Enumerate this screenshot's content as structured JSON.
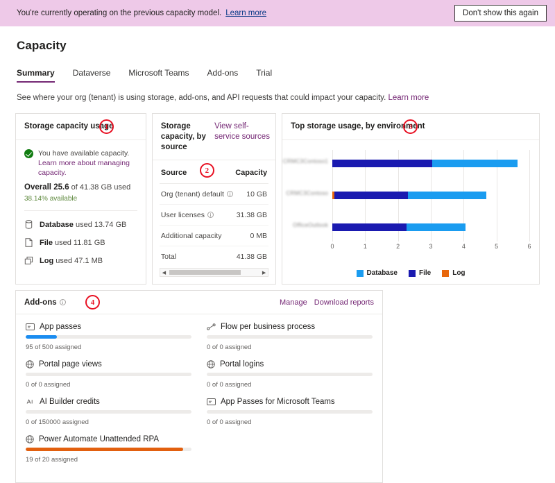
{
  "banner": {
    "text": "You're currently operating on the previous capacity model.",
    "link": "Learn more",
    "dismiss_label": "Don't show this again",
    "background": "#eec9e8"
  },
  "header": {
    "title": "Capacity",
    "subtitle": "See where your org (tenant) is using storage, add-ons, and API requests that could impact your capacity.",
    "subtitle_link": "Learn more"
  },
  "tabs": [
    {
      "label": "Summary",
      "active": true
    },
    {
      "label": "Dataverse",
      "active": false
    },
    {
      "label": "Microsoft Teams",
      "active": false
    },
    {
      "label": "Add-ons",
      "active": false
    },
    {
      "label": "Trial",
      "active": false
    }
  ],
  "annotations": [
    {
      "number": "1"
    },
    {
      "number": "2"
    },
    {
      "number": "3"
    },
    {
      "number": "4"
    }
  ],
  "storage_usage": {
    "title": "Storage capacity usage",
    "alert_text": "You have available capacity.",
    "alert_link": "Learn more about managing capacity.",
    "overall_prefix": "Overall",
    "overall_value": "25.6",
    "overall_suffix": "of 41.38 GB used",
    "available": "38.14% available",
    "items": [
      {
        "icon": "database-icon",
        "name": "Database",
        "detail": "used 13.74 GB"
      },
      {
        "icon": "file-icon",
        "name": "File",
        "detail": "used 11.81 GB"
      },
      {
        "icon": "log-icon",
        "name": "Log",
        "detail": "used 47.1 MB"
      }
    ]
  },
  "by_source": {
    "title": "Storage capacity, by source",
    "head_link": "View self-service sources",
    "columns": [
      "Source",
      "Capacity"
    ],
    "rows": [
      {
        "source": "Org (tenant) default",
        "info": true,
        "capacity": "10 GB"
      },
      {
        "source": "User licenses",
        "info": true,
        "capacity": "31.38 GB"
      },
      {
        "source": "Additional capacity",
        "info": false,
        "capacity": "0 MB"
      },
      {
        "source": "Total",
        "info": false,
        "capacity": "41.38 GB"
      }
    ]
  },
  "chart_data": {
    "type": "bar",
    "orientation": "horizontal",
    "stacked": true,
    "title": "Top storage usage, by environment",
    "xlabel": "",
    "ylabel": "",
    "categories": [
      "CRMC3Contoso1",
      "CRMC3Contoso",
      "OfficeOutlook"
    ],
    "categories_blurred": true,
    "series": [
      {
        "name": "Log",
        "color": "#e8670c",
        "values": [
          0,
          0.04,
          0
        ]
      },
      {
        "name": "File",
        "color": "#1a1ab0",
        "values": [
          3.05,
          2.31,
          2.25
        ]
      },
      {
        "name": "Database",
        "color": "#1a9cf0",
        "values": [
          2.6,
          2.35,
          1.8
        ]
      }
    ],
    "totals": [
      5.65,
      4.7,
      4.05
    ],
    "xlim": [
      0,
      6
    ],
    "xticks": [
      "0",
      "1",
      "2",
      "3",
      "4",
      "5",
      "6"
    ],
    "grid": true,
    "legend": [
      "Database",
      "File",
      "Log"
    ],
    "legend_position": "bottom"
  },
  "addons": {
    "title": "Add-ons",
    "links": [
      "Manage",
      "Download reports"
    ],
    "items": [
      {
        "icon": "badge-icon",
        "label": "App passes",
        "assigned": 95,
        "total": 500,
        "sub": "95 of 500 assigned",
        "color": "#1a8cf0",
        "percent": 19
      },
      {
        "icon": "flow-icon",
        "label": "Flow per business process",
        "assigned": 0,
        "total": 0,
        "sub": "0 of 0 assigned",
        "color": "#1a8cf0",
        "percent": 0
      },
      {
        "icon": "globe-icon",
        "label": "Portal page views",
        "assigned": 0,
        "total": 0,
        "sub": "0 of 0 assigned",
        "color": "#1a8cf0",
        "percent": 0
      },
      {
        "icon": "globe-icon",
        "label": "Portal logins",
        "assigned": 0,
        "total": 0,
        "sub": "0 of 0 assigned",
        "color": "#1a8cf0",
        "percent": 0
      },
      {
        "icon": "ai-icon",
        "label": "AI Builder credits",
        "assigned": 0,
        "total": 150000,
        "sub": "0 of 150000 assigned",
        "color": "#1a8cf0",
        "percent": 0
      },
      {
        "icon": "badge-icon",
        "label": "App Passes for Microsoft Teams",
        "assigned": 0,
        "total": 0,
        "sub": "0 of 0 assigned",
        "color": "#1a8cf0",
        "percent": 0
      },
      {
        "icon": "globe-icon",
        "label": "Power Automate Unattended RPA",
        "assigned": 19,
        "total": 20,
        "sub": "19 of 20 assigned",
        "color": "#e2５6",
        "percent": 95
      }
    ]
  },
  "colors": {
    "accent": "#742774",
    "banner": "#eec9e8",
    "database": "#1a9cf0",
    "file": "#1a1ab0",
    "log": "#e8670c",
    "annotation": "#e81123",
    "progress_blue": "#1a8cf0",
    "progress_orange": "#e2600f"
  }
}
